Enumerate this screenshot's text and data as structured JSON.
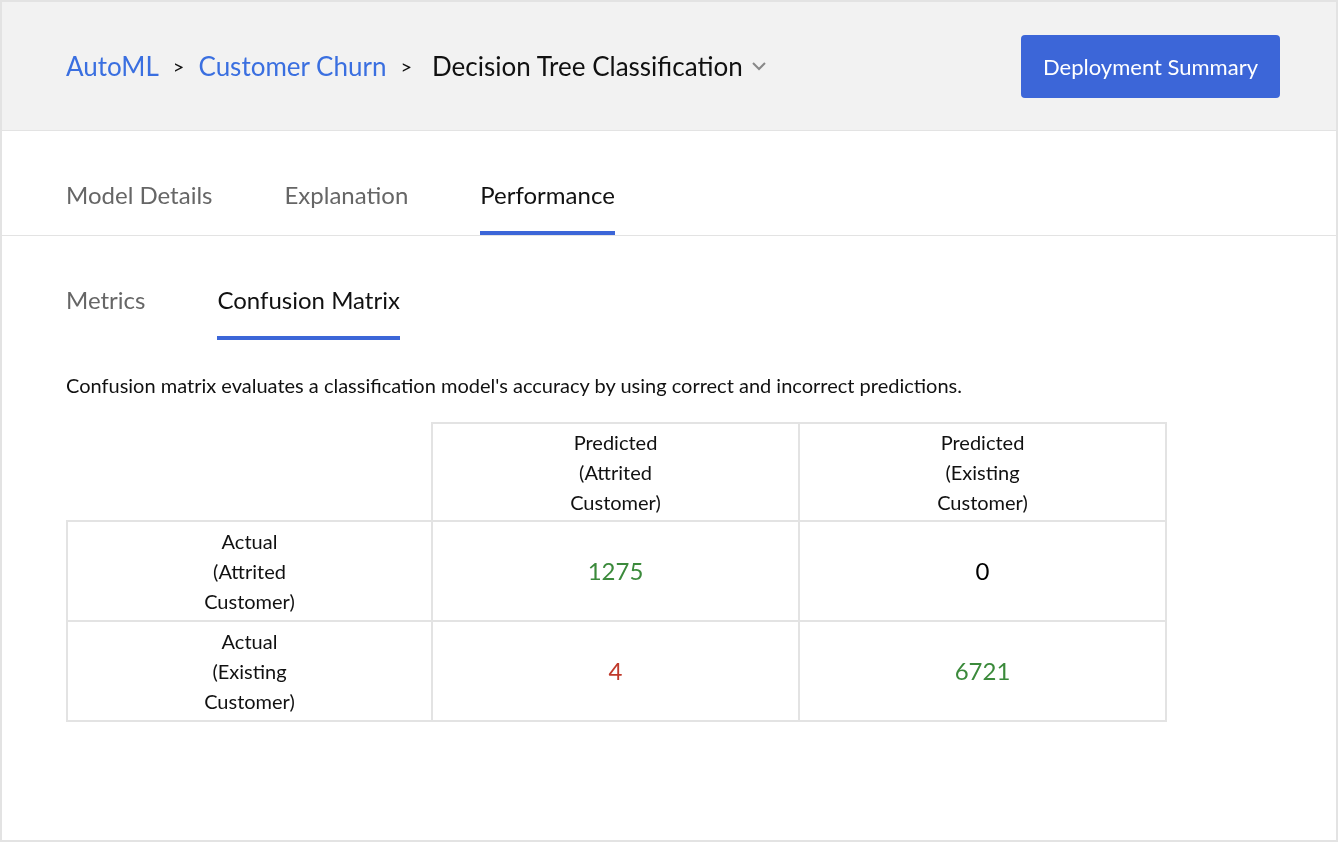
{
  "breadcrumb": [
    {
      "label": "AutoML",
      "kind": "link"
    },
    {
      "label": "Customer Churn",
      "kind": "link"
    },
    {
      "label": "Decision Tree Classification",
      "kind": "current"
    }
  ],
  "breadcrumb_separator": ">",
  "header_button": "Deployment Summary",
  "tabs": [
    {
      "label": "Model Details",
      "selected": false
    },
    {
      "label": "Explanation",
      "selected": false
    },
    {
      "label": "Performance",
      "selected": true
    }
  ],
  "subtabs": [
    {
      "label": "Metrics",
      "selected": false
    },
    {
      "label": "Confusion Matrix",
      "selected": true
    }
  ],
  "description": "Confusion matrix evaluates a classification model's accuracy by using correct and incorrect predictions.",
  "table": {
    "columns": [
      "Predicted (Attrited Customer)",
      "Predicted (Existing Customer)"
    ],
    "rows": [
      {
        "label": "Actual (Attrited Customer)",
        "cells": [
          {
            "value": "1275",
            "color": "#3b8a3b"
          },
          {
            "value": "0",
            "color": "#000000"
          }
        ]
      },
      {
        "label": "Actual (Existing Customer)",
        "cells": [
          {
            "value": "4",
            "color": "#c0392b"
          },
          {
            "value": "6721",
            "color": "#3b8a3b"
          }
        ]
      }
    ]
  }
}
